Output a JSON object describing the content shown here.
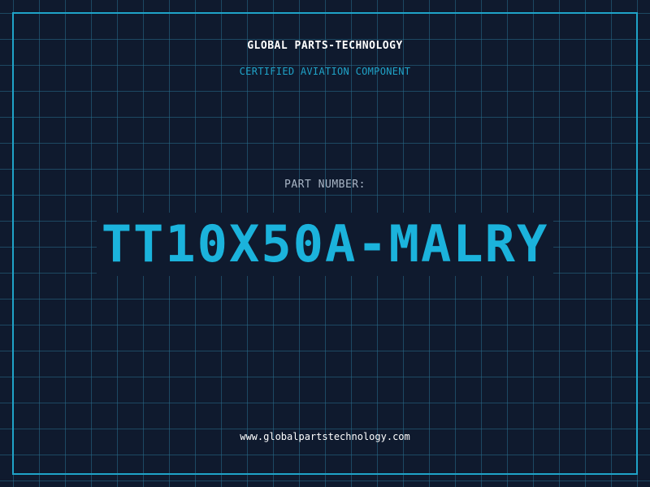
{
  "header": {
    "company": "GLOBAL PARTS-TECHNOLOGY",
    "tagline": "CERTIFIED AVIATION COMPONENT"
  },
  "part": {
    "label": "PART NUMBER:",
    "number": "TT10X50A-MALRY"
  },
  "footer": {
    "url": "www.globalpartstechnology.com"
  },
  "colors": {
    "background": "#0f1a2e",
    "accent": "#1fa3c8",
    "part_number": "#1bb3dc",
    "grid": "#286e8c"
  }
}
